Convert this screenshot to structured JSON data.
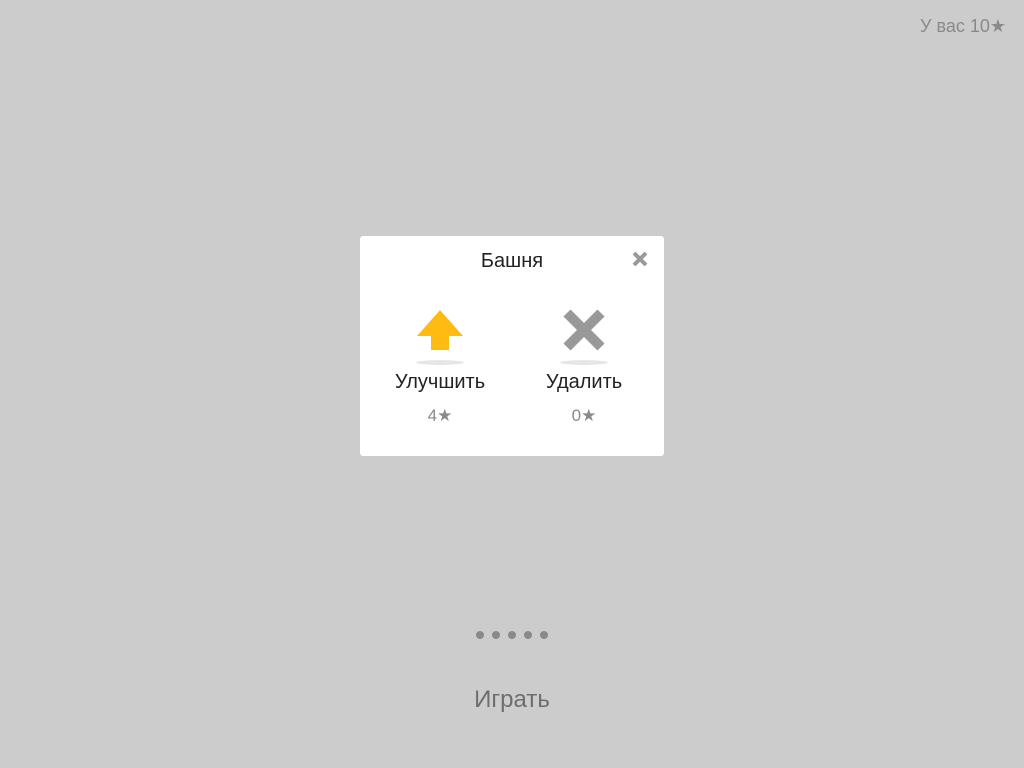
{
  "header": {
    "balance_text": "У вас 10★"
  },
  "modal": {
    "title": "Башня",
    "close_icon": "close-icon",
    "actions": [
      {
        "label": "Улучшить",
        "cost": "4★",
        "icon": "arrow-up-icon",
        "color": "#ffbb11"
      },
      {
        "label": "Удалить",
        "cost": "0★",
        "icon": "x-icon",
        "color": "#999999"
      }
    ]
  },
  "pager": {
    "dot_count": 5
  },
  "footer": {
    "play_label": "Играть"
  },
  "colors": {
    "background": "#cccccc",
    "panel": "#ffffff",
    "muted": "#8a8a8a"
  }
}
